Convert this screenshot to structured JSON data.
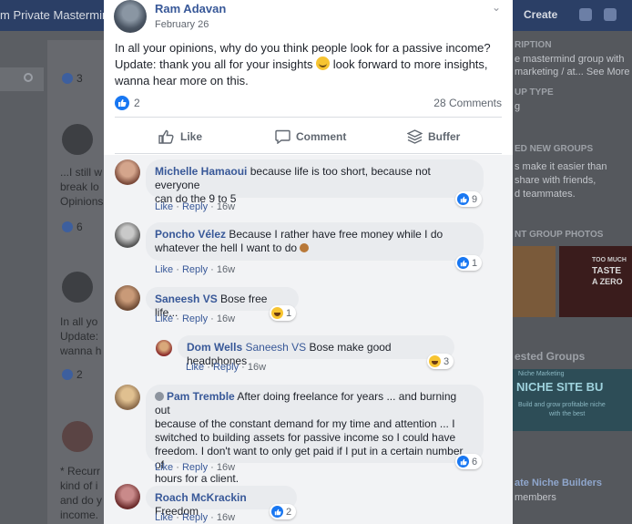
{
  "background": {
    "group_title": "m Private Mastermind",
    "create_label": "Create",
    "left_snippets": [
      "...I still w",
      "break lo",
      "Opinions",
      "In all yo",
      "Update:",
      "wanna h",
      "* Recurr",
      "kind of i",
      "and do y",
      "income."
    ],
    "left_like_counts": [
      "3",
      "6",
      "2"
    ],
    "right_panel": {
      "headings": [
        "RIPTION",
        "UP TYPE",
        "ED NEW GROUPS",
        "NT GROUP PHOTOS",
        "ested Groups"
      ],
      "description": [
        "e mastermind group with",
        "marketing / at... See More"
      ],
      "type_value": "g",
      "new_groups_text": [
        "s make it easier than",
        "share with friends,",
        "d teammates."
      ],
      "photo_text": [
        "TOO MUCH",
        "TASTE",
        "A ZERO"
      ],
      "suggested_banner": [
        "Niche Marketing",
        "NICHE SITE BU",
        "Build and grow profitable niche",
        "with the best"
      ],
      "suggested_name": "ate Niche Builders",
      "suggested_members": "members"
    }
  },
  "post": {
    "author": "Ram Adavan",
    "date": "February 26",
    "text_line1": "In all your opinions, why do you think people look for a passive income?",
    "text_line2_before": "Update: thank you all for your insights ",
    "text_line2_after": " look forward to more insights,",
    "text_line3": "wanna hear more on this.",
    "reaction_count": "2",
    "comment_count": "28 Comments",
    "actions": {
      "like": "Like",
      "comment": "Comment",
      "buffer": "Buffer"
    }
  },
  "comment_actions": {
    "like": "Like",
    "reply": "Reply"
  },
  "comments": [
    {
      "name": "Michelle Hamaoui",
      "text1": "because life is too short, because not everyone",
      "text2": "can do the 9 to 5",
      "time": "16w",
      "reaction": "like",
      "count": "9"
    },
    {
      "name": "Poncho Vélez",
      "text1": "Because I rather have free money while I do",
      "text2": "whatever the hell I want to do",
      "time": "16w",
      "reaction": "like",
      "count": "1"
    },
    {
      "name": "Saneesh VS",
      "text1": "Bose free life...",
      "time": "16w",
      "reaction": "haha",
      "count": "1"
    },
    {
      "name": "Dom Wells",
      "tag": "Saneesh VS",
      "text1": "Bose make good headphones",
      "time": "16w",
      "reaction": "haha",
      "count": "3"
    },
    {
      "name": "Pam Tremble",
      "text1": "After doing freelance for years ... and burning out",
      "text2": "because of the constant demand for my time and attention ... I",
      "text3": "switched to building assets for passive income so I could have",
      "text4": "freedom. I don't want to only get paid if I put in a certain number of",
      "text5": "hours for a client.",
      "time": "16w",
      "reaction": "like",
      "count": "6"
    },
    {
      "name": "Roach McKrackin",
      "text1": "Freedom",
      "time": "16w",
      "reaction": "like",
      "count": "2"
    }
  ],
  "colors": {
    "link_blue": "#385898",
    "fb_blue": "#1877f2",
    "bubble": "#e9ebee",
    "meta_gray": "#616770"
  }
}
